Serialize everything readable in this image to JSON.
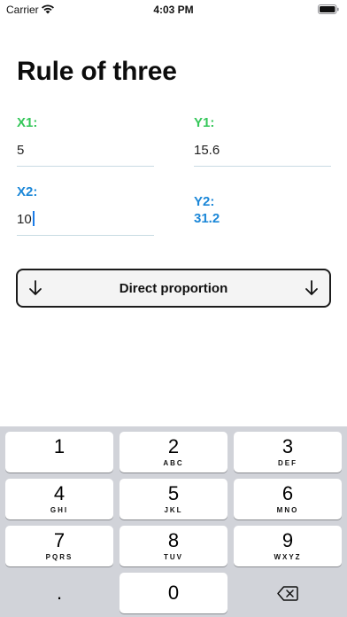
{
  "status_bar": {
    "carrier": "Carrier",
    "time": "4:03 PM"
  },
  "title": "Rule of three",
  "fields": {
    "x1": {
      "label": "X1:",
      "value": "5"
    },
    "y1": {
      "label": "Y1:",
      "value": "15.6"
    },
    "x2": {
      "label": "X2:",
      "value": "10"
    },
    "y2": {
      "label": "Y2:",
      "value": "31.2"
    }
  },
  "proportion_button": {
    "label": "Direct proportion",
    "icon": "arrow-down-icon"
  },
  "colors": {
    "green_label": "#34c759",
    "blue_label": "#1b87d8",
    "keyboard_background": "#d1d3d9"
  },
  "keyboard": {
    "keys": [
      {
        "digit": "1",
        "letters": ""
      },
      {
        "digit": "2",
        "letters": "ABC"
      },
      {
        "digit": "3",
        "letters": "DEF"
      },
      {
        "digit": "4",
        "letters": "GHI"
      },
      {
        "digit": "5",
        "letters": "JKL"
      },
      {
        "digit": "6",
        "letters": "MNO"
      },
      {
        "digit": "7",
        "letters": "PQRS"
      },
      {
        "digit": "8",
        "letters": "TUV"
      },
      {
        "digit": "9",
        "letters": "WXYZ"
      }
    ],
    "decimal": ".",
    "zero": "0",
    "delete_icon": "delete-backspace-icon"
  }
}
